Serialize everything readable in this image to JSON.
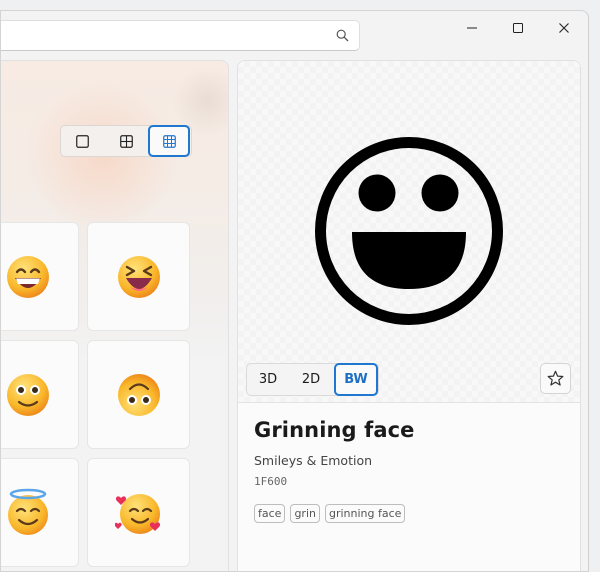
{
  "search": {
    "icon": "search-icon"
  },
  "titlebar": {
    "buttons": [
      "minimize-icon",
      "maximize-icon",
      "close-icon"
    ]
  },
  "view_toggle": {
    "options": [
      "large-grid-icon",
      "medium-grid-icon",
      "small-grid-icon"
    ],
    "selected_index": 2
  },
  "grid": {
    "emojis": [
      "😁",
      "😆",
      "🥲",
      "🙃",
      "😇",
      "🥰"
    ]
  },
  "detail": {
    "style_options": [
      "3D",
      "2D",
      "BW"
    ],
    "selected_style": "BW",
    "name": "Grinning face",
    "category": "Smileys & Emotion",
    "code": "1F600",
    "tags": [
      "face",
      "grin",
      "grinning face"
    ],
    "favorite_icon": "star-outline-icon"
  },
  "colors": {
    "accent": "#1f77d0"
  }
}
